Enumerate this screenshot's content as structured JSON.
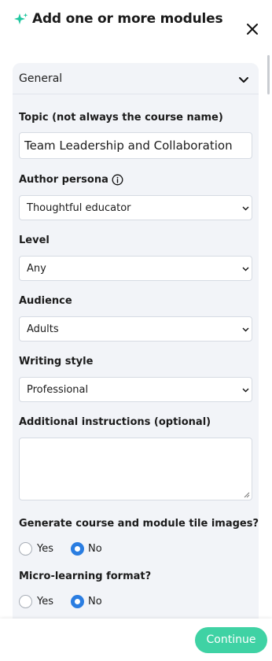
{
  "header": {
    "title": "Add one or more modules",
    "accent_color": "#22c7a0"
  },
  "panel": {
    "section_label": "General",
    "topic": {
      "label": "Topic (not always the course name)",
      "value": "Team Leadership and Collaboration"
    },
    "author_persona": {
      "label": "Author persona",
      "value": "Thoughtful educator"
    },
    "level": {
      "label": "Level",
      "value": "Any"
    },
    "audience": {
      "label": "Audience",
      "value": "Adults"
    },
    "writing_style": {
      "label": "Writing style",
      "value": "Professional"
    },
    "additional_instructions": {
      "label": "Additional instructions (optional)",
      "value": ""
    },
    "tile_images": {
      "label": "Generate course and module tile images?",
      "options": [
        "Yes",
        "No"
      ],
      "selected": "No"
    },
    "micro_learning": {
      "label": "Micro-learning format?",
      "options": [
        "Yes",
        "No"
      ],
      "selected": "No"
    }
  },
  "footer": {
    "continue_label": "Continue",
    "continue_color": "#3fd2a4",
    "radio_selected_color": "#2a7de1"
  }
}
